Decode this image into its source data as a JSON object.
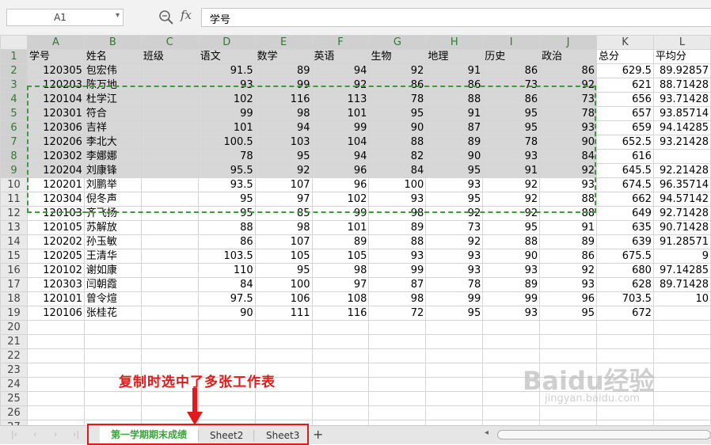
{
  "formula_bar": {
    "cell_ref": "A1",
    "fx_label": "fx",
    "content": "学号"
  },
  "columns": [
    "A",
    "B",
    "C",
    "D",
    "E",
    "F",
    "G",
    "H",
    "I",
    "J",
    "K",
    "L"
  ],
  "selected_columns": [
    "A",
    "B",
    "C",
    "D",
    "E",
    "F",
    "G",
    "H",
    "I",
    "J"
  ],
  "selected_rows_count": 9,
  "header": [
    "学号",
    "姓名",
    "班级",
    "语文",
    "数学",
    "英语",
    "生物",
    "地理",
    "历史",
    "政治",
    "总分",
    "平均分"
  ],
  "rows": [
    [
      "120305",
      "包宏伟",
      "",
      "91.5",
      "89",
      "94",
      "92",
      "91",
      "86",
      "86",
      "629.5",
      "89.92857"
    ],
    [
      "120203",
      "陈万地",
      "",
      "93",
      "99",
      "92",
      "86",
      "86",
      "73",
      "92",
      "621",
      "88.71428"
    ],
    [
      "120104",
      "杜学江",
      "",
      "102",
      "116",
      "113",
      "78",
      "88",
      "86",
      "73",
      "656",
      "93.71428"
    ],
    [
      "120301",
      "符合",
      "",
      "99",
      "98",
      "101",
      "95",
      "91",
      "95",
      "78",
      "657",
      "93.85714"
    ],
    [
      "120306",
      "吉祥",
      "",
      "101",
      "94",
      "99",
      "90",
      "87",
      "95",
      "93",
      "659",
      "94.14285"
    ],
    [
      "120206",
      "李北大",
      "",
      "100.5",
      "103",
      "104",
      "88",
      "89",
      "78",
      "90",
      "652.5",
      "93.21428"
    ],
    [
      "120302",
      "李娜娜",
      "",
      "78",
      "95",
      "94",
      "82",
      "90",
      "93",
      "84",
      "616",
      ""
    ],
    [
      "120204",
      "刘康锋",
      "",
      "95.5",
      "92",
      "96",
      "84",
      "95",
      "91",
      "92",
      "645.5",
      "92.21428"
    ],
    [
      "120201",
      "刘鹏举",
      "",
      "93.5",
      "107",
      "96",
      "100",
      "93",
      "92",
      "93",
      "674.5",
      "96.35714"
    ],
    [
      "120304",
      "倪冬声",
      "",
      "95",
      "97",
      "102",
      "93",
      "95",
      "92",
      "88",
      "662",
      "94.57142"
    ],
    [
      "120103",
      "齐飞扬",
      "",
      "95",
      "85",
      "99",
      "98",
      "92",
      "92",
      "88",
      "649",
      "92.71428"
    ],
    [
      "120105",
      "苏解放",
      "",
      "88",
      "98",
      "101",
      "89",
      "73",
      "95",
      "91",
      "635",
      "90.71428"
    ],
    [
      "120202",
      "孙玉敏",
      "",
      "86",
      "107",
      "89",
      "88",
      "92",
      "88",
      "89",
      "639",
      "91.28571"
    ],
    [
      "120205",
      "王清华",
      "",
      "103.5",
      "105",
      "105",
      "93",
      "93",
      "90",
      "86",
      "675.5",
      "9"
    ],
    [
      "120102",
      "谢如康",
      "",
      "110",
      "95",
      "98",
      "99",
      "93",
      "93",
      "92",
      "680",
      "97.14285"
    ],
    [
      "120303",
      "闫朝霞",
      "",
      "84",
      "100",
      "97",
      "87",
      "78",
      "89",
      "93",
      "628",
      "89.71428"
    ],
    [
      "120101",
      "曾令煊",
      "",
      "97.5",
      "106",
      "108",
      "98",
      "99",
      "99",
      "96",
      "703.5",
      "10"
    ],
    [
      "120106",
      "张桂花",
      "",
      "90",
      "111",
      "116",
      "72",
      "95",
      "93",
      "95",
      "672",
      ""
    ]
  ],
  "empty_row_numbers": [
    20,
    21,
    22,
    23,
    24,
    25,
    26,
    27
  ],
  "annotation": "复制时选中了多张工作表",
  "watermark": {
    "main": "Baidu经验",
    "sub": "jingyan.baidu.com"
  },
  "tabs": [
    {
      "label": "第一学期期末成绩",
      "active": true
    },
    {
      "label": "Sheet2",
      "active": false
    },
    {
      "label": "Sheet3",
      "active": false
    }
  ],
  "add_sheet_label": "+",
  "nav_glyphs": [
    "|‹",
    "‹",
    "›",
    "›|"
  ],
  "colors": {
    "selection_dash": "#3d9b3d",
    "annotation": "#e11b1b",
    "active_tab_text": "#3aa33a"
  },
  "icons": [
    "zoom-icon",
    "fx-icon",
    "dropdown-arrow-icon",
    "arrow-down-icon"
  ]
}
